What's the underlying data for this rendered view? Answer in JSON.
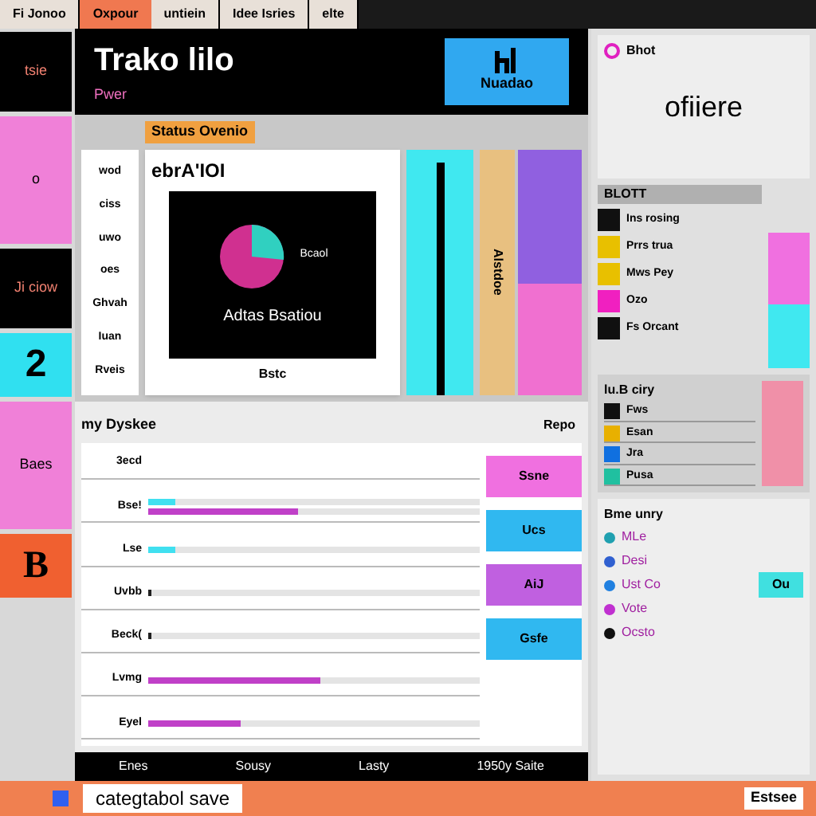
{
  "top_tabs": [
    {
      "label": "Fi Jonoo",
      "selected": false
    },
    {
      "label": "Oxpour",
      "selected": true
    },
    {
      "label": "untiein",
      "selected": false
    },
    {
      "label": "Idee Isries",
      "selected": false
    },
    {
      "label": "elte",
      "selected": false
    }
  ],
  "left_rail": [
    {
      "kind": "dark",
      "label": "tsie"
    },
    {
      "kind": "pink",
      "label": "o"
    },
    {
      "kind": "dark",
      "label": "Ji ciow"
    },
    {
      "kind": "cyan",
      "label": "2"
    },
    {
      "kind": "pink",
      "label": "Baes"
    },
    {
      "kind": "orange",
      "label": "B"
    }
  ],
  "header": {
    "title": "Trako lilo",
    "subtitle": "Pwer",
    "badge": "Nuadao"
  },
  "overview": {
    "label": "Status Ovenio",
    "card_title": "ebrA'IOI",
    "side_labels": [
      "wod",
      "ciss",
      "uwo",
      "oes",
      "Ghvah",
      "Iuan",
      "Rveis"
    ],
    "chart_caption": "Adtas Bsatiou",
    "legend": "Bcaol",
    "card_footer": "Bstc",
    "vertical_label": "Alstdoe"
  },
  "table": {
    "title": "my Dyskee",
    "action": "Repo",
    "rows": [
      {
        "label": "3ecd",
        "bars": []
      },
      {
        "label": "Bse!",
        "bars": [
          {
            "color": "#40e0f0",
            "level": 0.08
          },
          {
            "color": "#c040c8",
            "level": 0.45
          }
        ]
      },
      {
        "label": "Lse",
        "bars": [
          {
            "color": "#40e0f0",
            "level": 0.08
          }
        ]
      },
      {
        "label": "Uvbb",
        "bars": [
          {
            "color": "#202020",
            "level": 0.01
          }
        ]
      },
      {
        "label": "Beck(",
        "bars": [
          {
            "color": "#202020",
            "level": 0.01
          }
        ]
      },
      {
        "label": "Lvmg",
        "bars": [
          {
            "color": "#c040c8",
            "level": 0.52
          }
        ]
      },
      {
        "label": "Eyel",
        "bars": [
          {
            "color": "#c040c8",
            "level": 0.28
          }
        ]
      }
    ],
    "badges": [
      {
        "label": "Ssne",
        "color": "#f070e0"
      },
      {
        "label": "Ucs",
        "color": "#30b8f0"
      },
      {
        "label": "AiJ",
        "color": "#c060e0"
      },
      {
        "label": "Gsfe",
        "color": "#30b8f0"
      }
    ]
  },
  "footer": [
    "Enes",
    "Sousy",
    "Lasty",
    "1950y Saite"
  ],
  "bottom_bar": {
    "text": "categtabol save",
    "right": "Estsee"
  },
  "right": {
    "brand_small": "Bhot",
    "brand": "ofiiere",
    "list_title": "BLOTT",
    "items": [
      {
        "label": "Ins rosing",
        "color": "#101010"
      },
      {
        "label": "Prrs trua",
        "color": "#e8c000"
      },
      {
        "label": "Mws Pey",
        "color": "#e8c000"
      },
      {
        "label": "Ozo",
        "color": "#f020c0"
      },
      {
        "label": "Fs Orcant",
        "color": "#101010"
      }
    ],
    "entries_title": "lu.B ciry",
    "entries": [
      {
        "label": "Fws",
        "color": "#101010"
      },
      {
        "label": "Esan",
        "color": "#e8b000"
      },
      {
        "label": "Jra",
        "color": "#1070e0"
      },
      {
        "label": "Pusa",
        "color": "#20c0a0"
      }
    ],
    "contacts_title": "Bme unry",
    "contacts": [
      {
        "label": "MLe",
        "color": "#20a0b0"
      },
      {
        "label": "Desi",
        "color": "#3060d0"
      },
      {
        "label": "Ust Co",
        "color": "#2080e0"
      },
      {
        "label": "Vote",
        "color": "#c030d0"
      },
      {
        "label": "Ocsto",
        "color": "#101010"
      }
    ],
    "chip": "Ou"
  }
}
